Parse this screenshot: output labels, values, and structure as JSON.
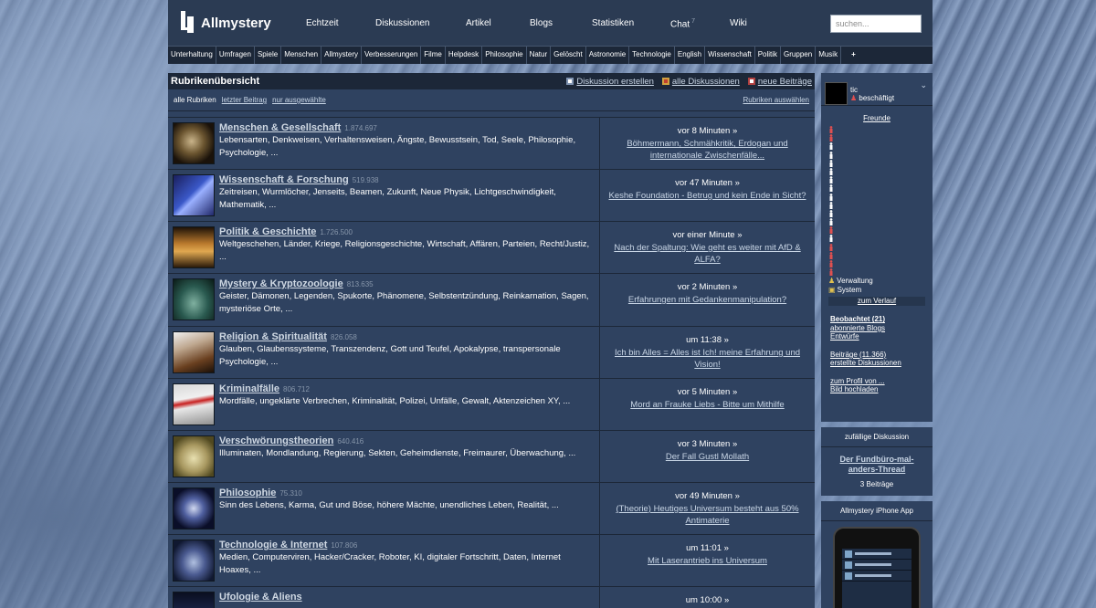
{
  "header": {
    "logo": "Allmystery",
    "nav": [
      "Echtzeit",
      "Diskussionen",
      "Artikel",
      "Blogs",
      "Statistiken",
      "Chat",
      "Wiki"
    ],
    "chat_badge": "7",
    "search_placeholder": "suchen..."
  },
  "categories": [
    "Unterhaltung",
    "Umfragen",
    "Spiele",
    "Menschen",
    "Allmystery",
    "Verbesserungen",
    "Filme",
    "Helpdesk",
    "Philosophie",
    "Natur",
    "Gelöscht",
    "Astronomie",
    "Technologie",
    "English",
    "Wissenschaft",
    "Politik",
    "Gruppen",
    "Musik",
    "+"
  ],
  "main": {
    "title": "Rubrikenübersicht",
    "actions": [
      "Diskussion erstellen",
      "alle Diskussionen",
      "neue Beiträge"
    ],
    "tabs": [
      "alle Rubriken",
      "letzter Beitrag",
      "nur ausgewählte"
    ],
    "select_label": "Rubriken auswählen",
    "rows": [
      {
        "title": "Menschen & Gesellschaft",
        "count": "1.874.697",
        "desc": "Lebensarten, Denkweisen, Verhaltensweisen, Ängste, Bewusstsein, Tod, Seele, Philosophie, Psychologie, ...",
        "time": "vor 8 Minuten »",
        "latest": "Böhmermann, Schmähkritik, Erdogan und internationale Zwischenfälle..."
      },
      {
        "title": "Wissenschaft & Forschung",
        "count": "519.938",
        "desc": "Zeitreisen, Wurmlöcher, Jenseits, Beamen, Zukunft, Neue Physik, Lichtgeschwindigkeit, Mathematik, ...",
        "time": "vor 47 Minuten »",
        "latest": "Keshe Foundation - Betrug und kein Ende in Sicht?"
      },
      {
        "title": "Politik & Geschichte",
        "count": "1.726.500",
        "desc": "Weltgeschehen, Länder, Kriege, Religionsgeschichte, Wirtschaft, Affären, Parteien, Recht/Justiz, ...",
        "time": "vor einer Minute »",
        "latest": "Nach der Spaltung: Wie geht es weiter mit AfD & ALFA?"
      },
      {
        "title": "Mystery & Kryptozoologie",
        "count": "813.635",
        "desc": "Geister, Dämonen, Legenden, Spukorte, Phänomene, Selbstentzündung, Reinkarnation, Sagen, mysteriöse Orte, ...",
        "time": "vor 2 Minuten »",
        "latest": "Erfahrungen mit Gedankenmanipulation?"
      },
      {
        "title": "Religion & Spiritualität",
        "count": "826.058",
        "desc": "Glauben, Glaubenssysteme, Transzendenz, Gott und Teufel, Apokalypse, transpersonale Psychologie, ...",
        "time": "um 11:38 »",
        "latest": "Ich bin Alles = Alles ist Ich! meine Erfahrung und Vision!"
      },
      {
        "title": "Kriminalfälle",
        "count": "806.712",
        "desc": "Mordfälle, ungeklärte Verbrechen, Kriminalität, Polizei, Unfälle, Gewalt, Aktenzeichen XY, ...",
        "time": "vor 5 Minuten »",
        "latest": "Mord an Frauke Liebs - Bitte um Mithilfe"
      },
      {
        "title": "Verschwörungstheorien",
        "count": "640.416",
        "desc": "Illuminaten, Mondlandung, Regierung, Sekten, Geheimdienste, Freimaurer, Überwachung, ...",
        "time": "vor 3 Minuten »",
        "latest": "Der Fall Gustl Mollath"
      },
      {
        "title": "Philosophie",
        "count": "75.310",
        "desc": "Sinn des Lebens, Karma, Gut und Böse, höhere Mächte, unendliches Leben, Realität, ...",
        "time": "vor 49 Minuten »",
        "latest": "(Theorie) Heutiges Universum besteht aus 50% Antimaterie"
      },
      {
        "title": "Technologie & Internet",
        "count": "107.806",
        "desc": "Medien, Computerviren, Hacker/Cracker, Roboter, KI, digitaler Fortschritt, Daten, Internet Hoaxes, ...",
        "time": "um 11:01 »",
        "latest": "Mit Laserantrieb ins Universum"
      },
      {
        "title": "Ufologie & Aliens",
        "count": "",
        "desc": "",
        "time": "um 10:00 »",
        "latest": ""
      }
    ]
  },
  "sidebar": {
    "user_name": "tic",
    "user_status": "beschäftigt",
    "friends_title": "Freunde",
    "friend_colors": [
      "#e05050",
      "#e05050",
      "#ffffff",
      "#ffffff",
      "#ffffff",
      "#ffffff",
      "#ffffff",
      "#ffffff",
      "#ffffff",
      "#ffffff",
      "#ffffff",
      "#ffffff",
      "#e05050",
      "#ffffff",
      "#e05050",
      "#e05050",
      "#e05050",
      "#e05050"
    ],
    "legend": [
      "Verwaltung",
      "System"
    ],
    "history_link": "zum Verlauf",
    "links": [
      {
        "label": "Beobachtet (21)",
        "bold": true
      },
      {
        "label": "abonnierte Blogs",
        "bold": false
      },
      {
        "label": "Entwürfe",
        "bold": false
      },
      {
        "label": "",
        "bold": false
      },
      {
        "label": "Beiträge (11.366)",
        "bold": false
      },
      {
        "label": "erstellte Diskussionen",
        "bold": false
      },
      {
        "label": "",
        "bold": false
      },
      {
        "label": "zum Profil von ...",
        "bold": false
      },
      {
        "label": "Bild hochladen",
        "bold": false
      }
    ],
    "random_head": "zufällige Diskussion",
    "random_title": "Der Fundbüro-mal-anders-Thread",
    "random_count": "3 Beiträge",
    "app_head": "Allmystery iPhone App"
  }
}
